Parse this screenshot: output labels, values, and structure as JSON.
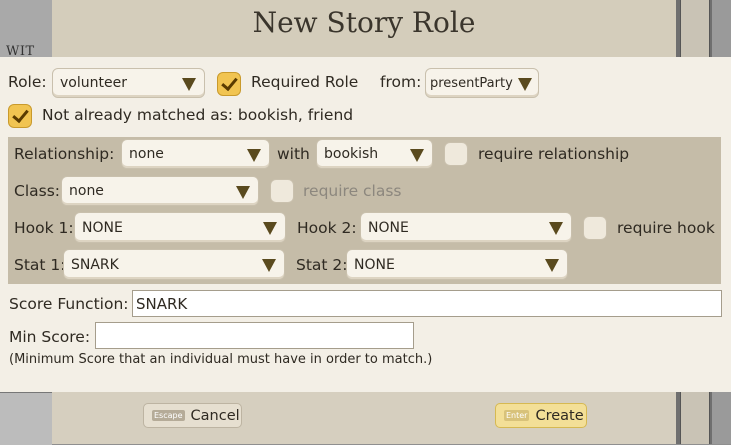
{
  "background": {
    "side_text": "WIT"
  },
  "dialog": {
    "title": "New Story Role",
    "role_label": "Role:",
    "role_value": "volunteer",
    "required_role_checked": true,
    "required_role_label": "Required Role",
    "from_label": "from:",
    "from_value": "presentParty",
    "not_matched_checked": true,
    "not_matched_label": "Not already matched as: bookish, friend",
    "relationship_label": "Relationship:",
    "relationship_value": "none",
    "with_label": "with",
    "with_value": "bookish",
    "require_relationship_checked": false,
    "require_relationship_label": "require relationship",
    "class_label": "Class:",
    "class_value": "none",
    "require_class_checked": false,
    "require_class_label": "require class",
    "hook1_label": "Hook 1:",
    "hook1_value": "NONE",
    "hook2_label": "Hook 2:",
    "hook2_value": "NONE",
    "require_hook_checked": false,
    "require_hook_label": "require hook",
    "stat1_label": "Stat 1:",
    "stat1_value": "SNARK",
    "stat2_label": "Stat 2:",
    "stat2_value": "NONE",
    "score_function_label": "Score Function:",
    "score_function_value": "SNARK",
    "min_score_label": "Min Score:",
    "min_score_value": "",
    "min_score_hint": "(Minimum Score that an individual must have in order to match.)",
    "cancel_key": "Escape",
    "cancel_label": "Cancel",
    "create_key": "Enter",
    "create_label": "Create"
  },
  "colors": {
    "dialog_bg": "#f3efe6",
    "filter_band": "#c5bca8",
    "checkbox_on": "#f1c451",
    "create_button": "#f3df97"
  }
}
